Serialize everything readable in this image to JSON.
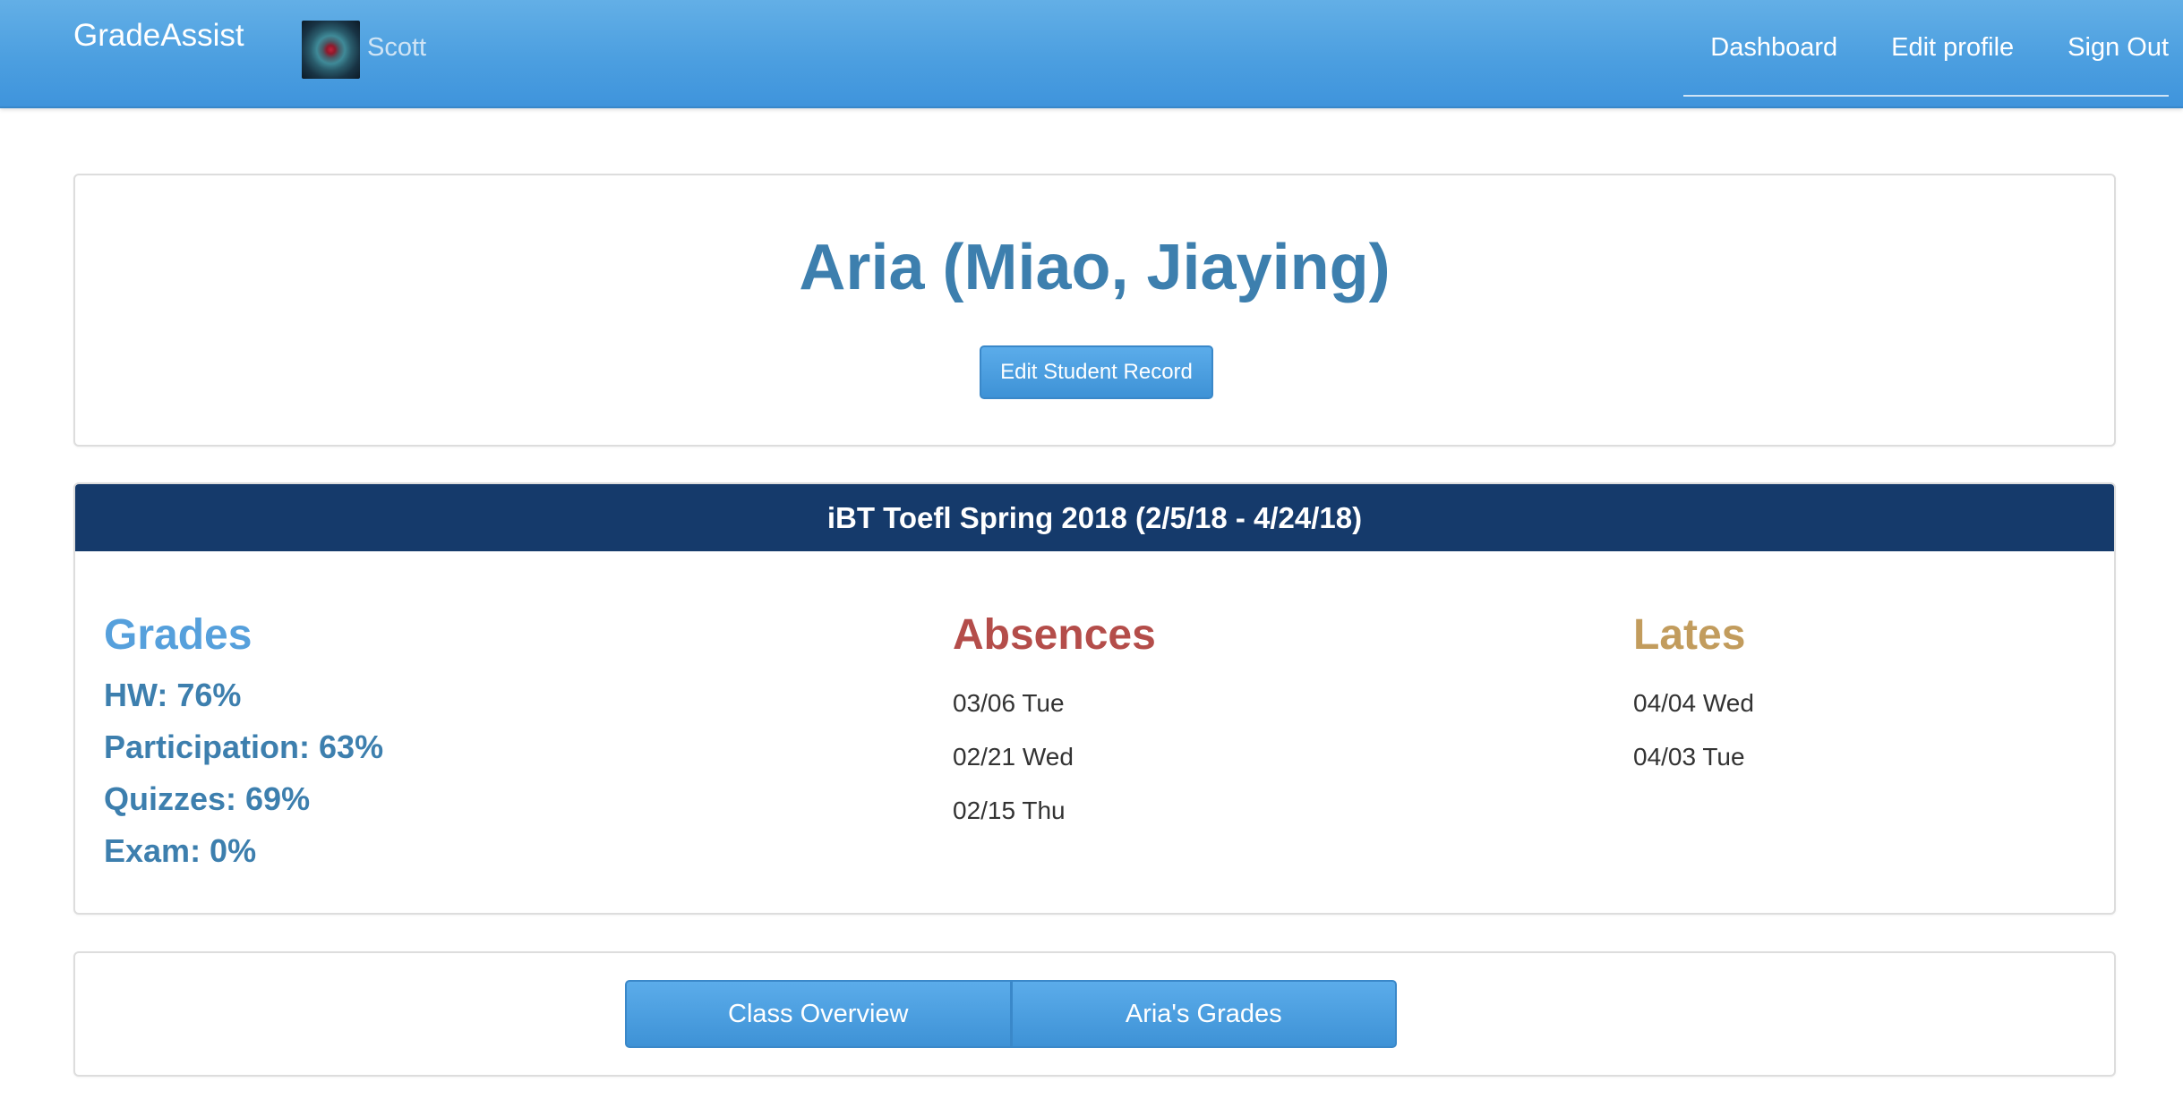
{
  "navbar": {
    "brand": "GradeAssist",
    "user_name": "Scott",
    "links": [
      "Dashboard",
      "Edit profile",
      "Sign Out"
    ]
  },
  "student": {
    "name": "Aria (Miao, Jiaying)",
    "edit_button": "Edit Student Record"
  },
  "course": {
    "title": "iBT Toefl Spring 2018 (2/5/18 - 4/24/18)",
    "grades": {
      "heading": "Grades",
      "items": [
        "HW: 76%",
        "Participation: 63%",
        "Quizzes: 69%",
        "Exam: 0%"
      ]
    },
    "absences": {
      "heading": "Absences",
      "items": [
        "03/06 Tue",
        "02/21 Wed",
        "02/15 Thu"
      ]
    },
    "lates": {
      "heading": "Lates",
      "items": [
        "04/04 Wed",
        "04/03 Tue"
      ]
    }
  },
  "bottom_nav": {
    "buttons": [
      "Class Overview",
      "Aria's Grades"
    ]
  },
  "colors": {
    "navbar": "#4c9fe0",
    "course_bar": "#153a6b",
    "grades_heading": "#56a0dc",
    "absences_heading": "#b44d4a",
    "lates_heading": "#c29c5d",
    "grade_text": "#3d7fae"
  }
}
